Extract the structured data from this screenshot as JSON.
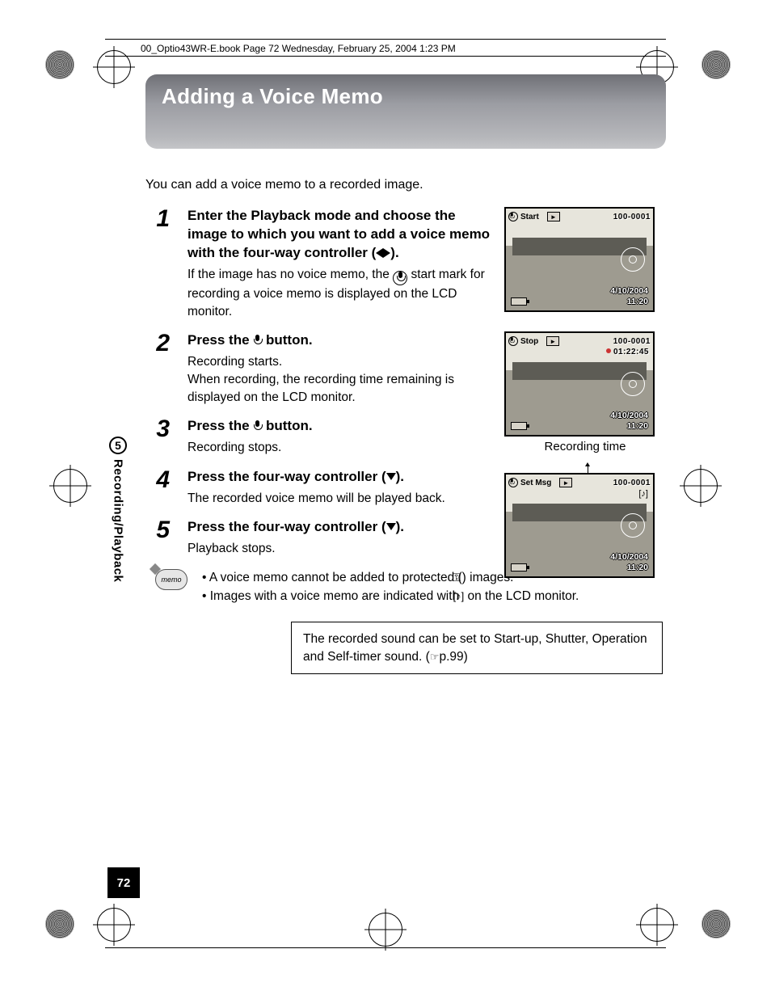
{
  "header_line": "00_Optio43WR-E.book  Page 72  Wednesday, February 25, 2004  1:23 PM",
  "title": "Adding a Voice Memo",
  "intro": "You can add a voice memo to a recorded image.",
  "steps": [
    {
      "num": "1",
      "heading_parts": [
        "Enter the Playback mode and choose the image to which you want to add a voice memo with the four-way controller (",
        ")."
      ],
      "body_parts": [
        "If the image has no voice memo, the ",
        " start mark for recording a voice memo is displayed on the LCD monitor."
      ]
    },
    {
      "num": "2",
      "heading_parts": [
        "Press the ",
        " button."
      ],
      "body_parts": [
        "Recording starts.",
        "When recording, the recording time remaining is displayed on the LCD monitor."
      ]
    },
    {
      "num": "3",
      "heading_parts": [
        "Press the ",
        " button."
      ],
      "body_parts": [
        "Recording stops."
      ]
    },
    {
      "num": "4",
      "heading_parts": [
        "Press the four-way controller (",
        ")."
      ],
      "body_parts": [
        "The recorded voice memo will be played back."
      ]
    },
    {
      "num": "5",
      "heading_parts": [
        "Press the four-way controller (",
        ")."
      ],
      "body_parts": [
        "Playback stops."
      ]
    }
  ],
  "lcd": {
    "start_label": "Start",
    "stop_label": "Stop",
    "set_msg_label": "Set Msg",
    "file_number": "100-0001",
    "rec_time": "01:22:45",
    "date": "4/10/2004",
    "time": "11:20",
    "caption": "Recording time",
    "play_glyph": "►"
  },
  "memo": {
    "badge": "memo",
    "items": [
      {
        "before": "A voice memo cannot be added to protected (",
        "after": ") images."
      },
      {
        "before": "Images with a voice memo are indicated with ",
        "after": " on the LCD monitor."
      }
    ]
  },
  "ref_box": {
    "before": "The recorded sound can be set to Start-up, Shutter, Operation and Self-timer sound. (",
    "after": "p.99)"
  },
  "side": {
    "chapter": "5",
    "label": "Recording/Playback"
  },
  "page_number": "72"
}
